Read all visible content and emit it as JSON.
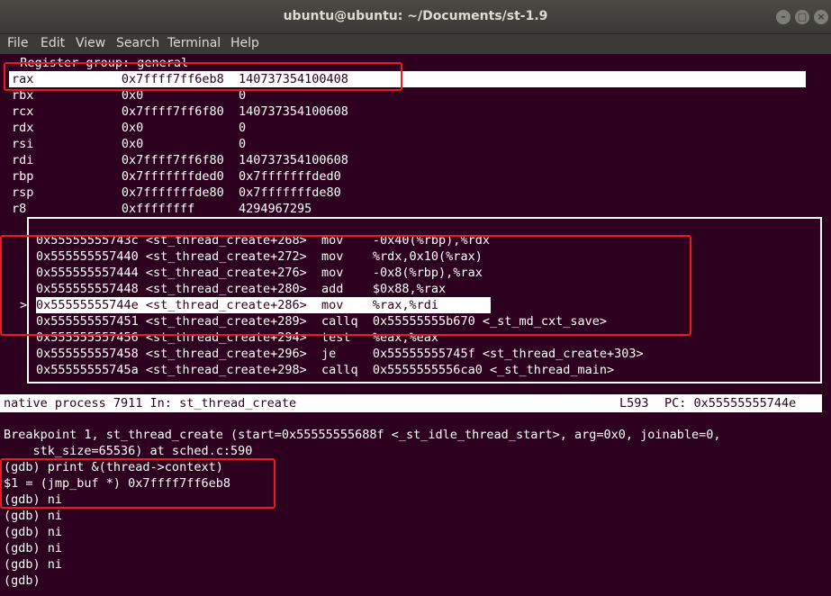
{
  "window": {
    "title": "ubuntu@ubuntu: ~/Documents/st-1.9"
  },
  "menu": [
    "File",
    "Edit",
    "View",
    "Search",
    "Terminal",
    "Help"
  ],
  "registers": {
    "header": "  Register group: general",
    "rows": [
      {
        "name": "rax",
        "hex": "0x7ffff7ff6eb8",
        "dec": "140737354100408"
      },
      {
        "name": "rbx",
        "hex": "0x0",
        "dec": "0"
      },
      {
        "name": "rcx",
        "hex": "0x7ffff7ff6f80",
        "dec": "140737354100608"
      },
      {
        "name": "rdx",
        "hex": "0x0",
        "dec": "0"
      },
      {
        "name": "rsi",
        "hex": "0x0",
        "dec": "0"
      },
      {
        "name": "rdi",
        "hex": "0x7ffff7ff6f80",
        "dec": "140737354100608"
      },
      {
        "name": "rbp",
        "hex": "0x7fffffffded0",
        "dec": "0x7fffffffded0"
      },
      {
        "name": "rsp",
        "hex": "0x7fffffffde80",
        "dec": "0x7fffffffde80"
      },
      {
        "name": "r8",
        "hex": "0xffffffff",
        "dec": "4294967295"
      }
    ]
  },
  "asm": [
    {
      "addr": "0x55555555743c",
      "sym": "<st_thread_create+268>",
      "op": "mov",
      "args": "-0x40(%rbp),%rdx"
    },
    {
      "addr": "0x555555557440",
      "sym": "<st_thread_create+272>",
      "op": "mov",
      "args": "%rdx,0x10(%rax)"
    },
    {
      "addr": "0x555555557444",
      "sym": "<st_thread_create+276>",
      "op": "mov",
      "args": "-0x8(%rbp),%rax"
    },
    {
      "addr": "0x555555557448",
      "sym": "<st_thread_create+280>",
      "op": "add",
      "args": "$0x88,%rax"
    },
    {
      "addr": "0x55555555744e",
      "sym": "<st_thread_create+286>",
      "op": "mov",
      "args": "%rax,%rdi"
    },
    {
      "addr": "0x555555557451",
      "sym": "<st_thread_create+289>",
      "op": "callq",
      "args": "0x55555555b670 <_st_md_cxt_save>"
    },
    {
      "addr": "0x555555557456",
      "sym": "<st_thread_create+294>",
      "op": "test",
      "args": "%eax,%eax"
    },
    {
      "addr": "0x555555557458",
      "sym": "<st_thread_create+296>",
      "op": "je",
      "args": "0x55555555745f <st_thread_create+303>"
    },
    {
      "addr": "0x55555555745a",
      "sym": "<st_thread_create+298>",
      "op": "callq",
      "args": "0x5555555556ca0 <_st_thread_main>"
    }
  ],
  "current_marker": ">",
  "status": {
    "left": "native process 7911 In: st_thread_create",
    "line": "L593",
    "pc": "PC: 0x55555555744e"
  },
  "console": [
    "Breakpoint 1, st_thread_create (start=0x55555555688f <_st_idle_thread_start>, arg=0x0, joinable=0,",
    "    stk_size=65536) at sched.c:590",
    "(gdb) print &(thread->context)",
    "$1 = (jmp_buf *) 0x7ffff7ff6eb8",
    "(gdb) ni",
    "(gdb) ni",
    "(gdb) ni",
    "(gdb) ni",
    "(gdb) ni",
    "(gdb)"
  ]
}
